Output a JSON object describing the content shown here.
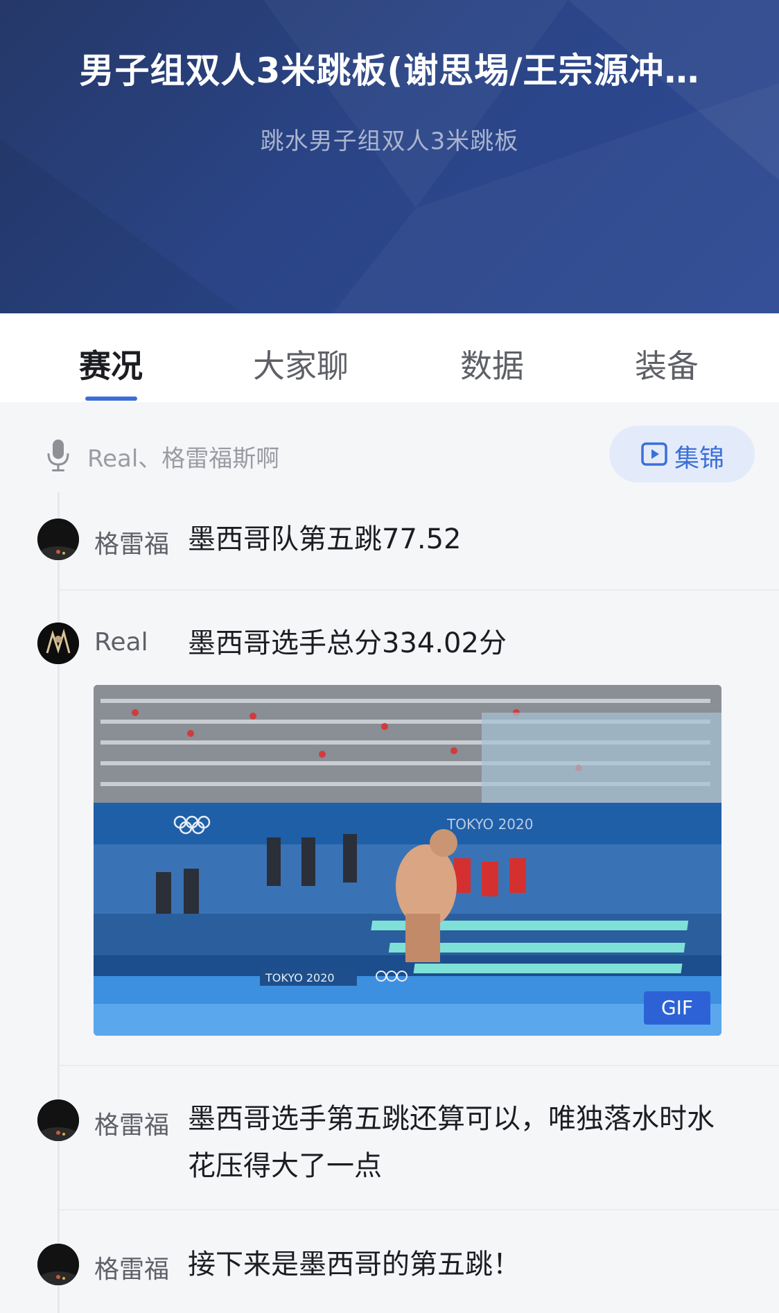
{
  "header": {
    "title": "男子组双人3米跳板(谢思埸/王宗源冲…",
    "subtitle": "跳水男子组双人3米跳板"
  },
  "tabs": [
    {
      "label": "赛况",
      "active": true
    },
    {
      "label": "大家聊",
      "active": false
    },
    {
      "label": "数据",
      "active": false
    },
    {
      "label": "装备",
      "active": false
    }
  ],
  "commentary": {
    "commentators": "Real、格雷福斯啊",
    "highlight_label": "集锦",
    "mic_icon": "microphone-icon",
    "play_icon": "play-icon"
  },
  "feed": [
    {
      "author": "格雷福",
      "text": "墨西哥队第五跳77.52"
    },
    {
      "author": "Real",
      "text": "墨西哥选手总分334.02分",
      "media": {
        "type": "gif",
        "badge": "GIF",
        "captions": [
          "TOKYO 2020",
          "TOKYO 2020"
        ]
      }
    },
    {
      "author": "格雷福",
      "text": "墨西哥选手第五跳还算可以，唯独落水时水花压得大了一点"
    },
    {
      "author": "格雷福",
      "text": "接下来是墨西哥的第五跳！"
    }
  ],
  "colors": {
    "accent": "#3b6fd8",
    "header_bg": "#2a4486",
    "highlight_bg": "#e3ebfb"
  }
}
